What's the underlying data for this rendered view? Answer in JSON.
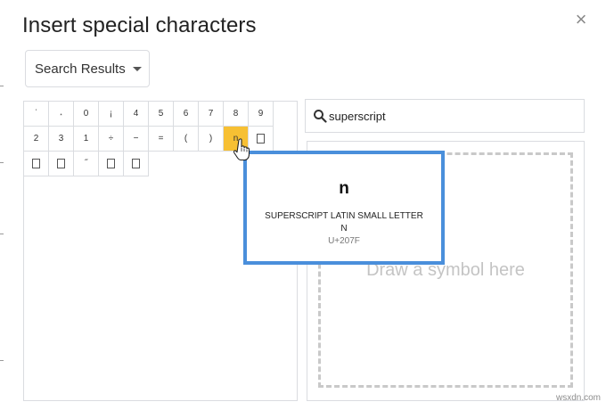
{
  "dialog": {
    "title": "Insert special characters",
    "close_label": "×",
    "dropdown_label": "Search Results"
  },
  "grid": {
    "rows": [
      [
        "ˈ",
        "˔",
        "0",
        "¡",
        "4",
        "5",
        "6",
        "7",
        "8",
        "9"
      ],
      [
        "2",
        "3",
        "1",
        "÷",
        "−",
        "=",
        "(",
        ")",
        "n",
        "□"
      ],
      [
        "□",
        "□",
        "˝",
        "□",
        "□"
      ]
    ],
    "selected": {
      "row": 1,
      "col": 8
    }
  },
  "search": {
    "value": "superscript",
    "placeholder": ""
  },
  "draw": {
    "label": "Draw a symbol here"
  },
  "tooltip": {
    "glyph": "n",
    "name": "SUPERSCRIPT LATIN SMALL LETTER N",
    "code": "U+207F"
  },
  "watermark": "wsxdn.com",
  "colors": {
    "selected_cell": "#f7c033",
    "tooltip_border": "#4a8fdb"
  },
  "icons": [
    "close-icon",
    "chevron-down-icon",
    "search-icon",
    "hand-cursor-icon"
  ]
}
